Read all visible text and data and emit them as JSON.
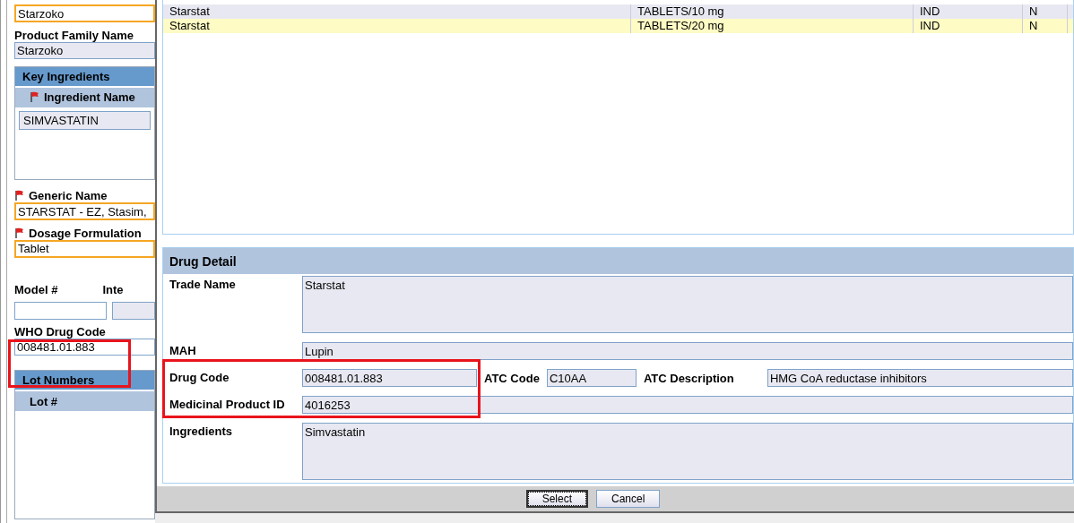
{
  "left_form": [
    {
      "kind": "field",
      "value": "Starzoko",
      "mandatory": true,
      "read_only": false
    },
    {
      "kind": "label",
      "text": "Product Family Name",
      "required": false
    },
    {
      "kind": "field",
      "value": "Starzoko",
      "mandatory": false,
      "read_only": true
    },
    {
      "kind": "table",
      "title": "Key Ingredients",
      "column": "Ingredient Name",
      "required": true,
      "rows": [
        "SIMVASTATIN"
      ]
    },
    {
      "kind": "label",
      "text": "Generic Name",
      "required": true
    },
    {
      "kind": "field",
      "value": "STARSTAT - EZ, Stasim,",
      "mandatory": true,
      "read_only": false
    },
    {
      "kind": "label",
      "text": "Dosage Formulation",
      "required": true
    },
    {
      "kind": "field",
      "value": "Tablet",
      "mandatory": true,
      "read_only": false
    },
    {
      "kind": "pair",
      "labels": [
        "Model #",
        "Inte"
      ]
    },
    {
      "kind": "label",
      "text": "WHO Drug Code",
      "required": false
    },
    {
      "kind": "field",
      "value": "008481.01.883",
      "mandatory": false,
      "read_only": false
    },
    {
      "kind": "table",
      "title": "Lot Numbers",
      "column": "Lot #",
      "required": false
    }
  ],
  "results": {
    "rows": [
      {
        "name": "Starstat",
        "form": "TABLETS/10 mg",
        "type": "IND",
        "flag": "N",
        "selected": false
      },
      {
        "name": "Starstat",
        "form": "TABLETS/20 mg",
        "type": "IND",
        "flag": "N",
        "selected": true
      }
    ]
  },
  "drug_detail": {
    "title": "Drug Detail",
    "trade_name": {
      "label": "Trade Name",
      "value": "Starstat"
    },
    "mah": {
      "label": "MAH",
      "value": "Lupin"
    },
    "drug_code": {
      "label": "Drug Code",
      "value": "008481.01.883"
    },
    "atc_code": {
      "label": "ATC Code",
      "value": "C10AA"
    },
    "atc_description": {
      "label": "ATC Description",
      "value": "HMG CoA reductase inhibitors"
    },
    "medicinal_product_id": {
      "label": "Medicinal Product ID",
      "value": "4016253"
    },
    "ingredients": {
      "label": "Ingredients",
      "value": "Simvastatin"
    }
  },
  "buttons": [
    {
      "label": "Select",
      "focused": true
    },
    {
      "label": "Cancel",
      "focused": false
    }
  ]
}
